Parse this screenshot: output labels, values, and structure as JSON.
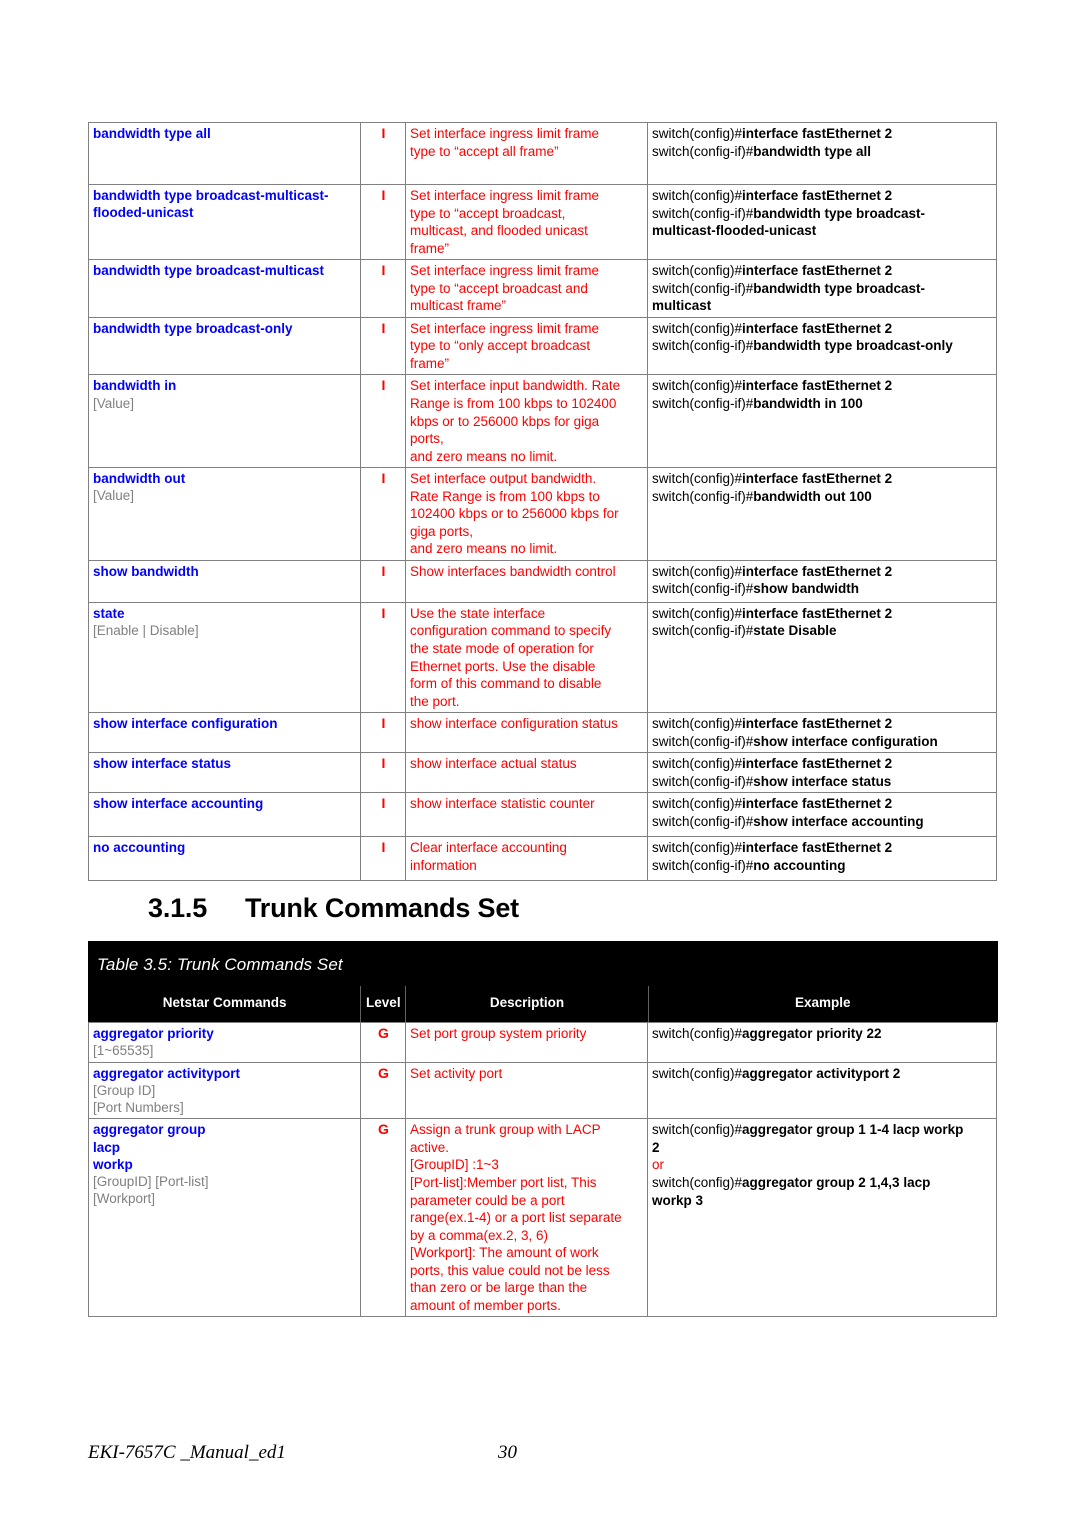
{
  "document": {
    "footer_doc_name": "EKI-7657C _Manual_ed1",
    "footer_page_number": "30"
  },
  "section": {
    "number": "3.1.5",
    "title": "Trunk Commands Set"
  },
  "colors": {
    "command_blue": "#0000FF",
    "description_red": "#FF0000",
    "param_gray": "#808080",
    "header_black": "#000000",
    "example_black": "#000000"
  },
  "table_interface": {
    "columns": [
      "Netstar Commands",
      "Level",
      "Description",
      "Example"
    ],
    "rows": [
      {
        "command": "bandwidth type all",
        "params": "",
        "level": "I",
        "description": "Set interface ingress limit frame\ntype to “accept all frame”",
        "example": [
          {
            "prefix": "switch(config)#",
            "cmd": "interface fastEthernet 2"
          },
          {
            "prefix": "switch(config-if)#",
            "cmd": "bandwidth type all"
          }
        ]
      },
      {
        "command": "bandwidth type broadcast-multicast-\nflooded-unicast",
        "params": "",
        "level": "I",
        "description": "Set interface ingress limit frame\ntype to “accept broadcast,\nmulticast, and flooded unicast\nframe”",
        "example": [
          {
            "prefix": "switch(config)#",
            "cmd": "interface fastEthernet 2"
          },
          {
            "prefix": "switch(config-if)#",
            "cmd": "bandwidth type broadcast-"
          },
          {
            "prefix": "",
            "cmd": "multicast-flooded-unicast"
          }
        ]
      },
      {
        "command": "bandwidth type broadcast-multicast",
        "params": "",
        "level": "I",
        "description": "Set interface ingress limit frame\ntype to “accept broadcast and\nmulticast frame”",
        "example": [
          {
            "prefix": "switch(config)#",
            "cmd": "interface fastEthernet 2"
          },
          {
            "prefix": "switch(config-if)#",
            "cmd": "bandwidth type broadcast-"
          },
          {
            "prefix": "",
            "cmd": "multicast"
          }
        ]
      },
      {
        "command": "bandwidth type broadcast-only",
        "params": "",
        "level": "I",
        "description": "Set interface ingress limit frame\ntype to “only accept broadcast\nframe”",
        "example": [
          {
            "prefix": "switch(config)#",
            "cmd": "interface fastEthernet 2"
          },
          {
            "prefix": "switch(config-if)#",
            "cmd": "bandwidth type broadcast-only"
          }
        ]
      },
      {
        "command": "bandwidth in",
        "params": "[Value]",
        "level": "I",
        "description": "Set interface input bandwidth. Rate\nRange is from 100 kbps to 102400\nkbps or to 256000 kbps for giga\nports,\nand zero means no limit.",
        "example": [
          {
            "prefix": "switch(config)#",
            "cmd": "interface fastEthernet 2"
          },
          {
            "prefix": "switch(config-if)#",
            "cmd": "bandwidth in 100"
          }
        ]
      },
      {
        "command": "bandwidth out",
        "params": "[Value]",
        "level": "I",
        "description": "Set interface output bandwidth.\nRate Range is from 100 kbps to\n102400 kbps or to 256000 kbps for\ngiga ports,\nand zero means no limit.",
        "example": [
          {
            "prefix": "switch(config)#",
            "cmd": "interface fastEthernet 2"
          },
          {
            "prefix": "switch(config-if)#",
            "cmd": "bandwidth out 100"
          }
        ]
      },
      {
        "command": "show bandwidth",
        "params": "",
        "level": "I",
        "description": "Show interfaces bandwidth control",
        "example": [
          {
            "prefix": "switch(config)#",
            "cmd": "interface fastEthernet 2"
          },
          {
            "prefix": "switch(config-if)#",
            "cmd": "show bandwidth"
          }
        ]
      },
      {
        "command": "state",
        "params": "[Enable | Disable]",
        "level": "I",
        "description": "Use the state interface\nconfiguration command to specify\nthe state mode of operation for\nEthernet ports. Use the disable\nform of this command to disable\nthe port.",
        "example": [
          {
            "prefix": "switch(config)#",
            "cmd": "interface fastEthernet 2"
          },
          {
            "prefix": "switch(config-if)#",
            "cmd": "state Disable"
          }
        ]
      },
      {
        "command": "show interface configuration",
        "params": "",
        "level": "I",
        "description": "show interface configuration status",
        "example": [
          {
            "prefix": "switch(config)#",
            "cmd": "interface fastEthernet 2"
          },
          {
            "prefix": "switch(config-if)#",
            "cmd": "show interface configuration"
          }
        ]
      },
      {
        "command": "show interface status",
        "params": "",
        "level": "I",
        "description": "show interface actual status",
        "example": [
          {
            "prefix": "switch(config)#",
            "cmd": "interface fastEthernet 2"
          },
          {
            "prefix": "switch(config-if)#",
            "cmd": "show interface status"
          }
        ]
      },
      {
        "command": "show interface accounting",
        "params": "",
        "level": "I",
        "description": "show interface statistic counter",
        "example": [
          {
            "prefix": "switch(config)#",
            "cmd": "interface fastEthernet 2"
          },
          {
            "prefix": "switch(config-if)#",
            "cmd": "show interface accounting"
          }
        ]
      },
      {
        "command": "no accounting",
        "params": "",
        "level": "I",
        "description": "Clear interface accounting\ninformation",
        "example": [
          {
            "prefix": "switch(config)#",
            "cmd": "interface fastEthernet 2"
          },
          {
            "prefix": "switch(config-if)#",
            "cmd": "no accounting"
          }
        ]
      }
    ]
  },
  "table_trunk": {
    "caption": "Table 3.5: Trunk  Commands Set",
    "columns": [
      "Netstar Commands",
      "Level",
      "Description",
      "Example"
    ],
    "rows": [
      {
        "command": "aggregator priority",
        "params": "[1~65535]",
        "level": "G",
        "description": "Set port group system priority",
        "example": [
          {
            "prefix": "switch(config)#",
            "cmd": "aggregator priority 22"
          }
        ]
      },
      {
        "command": "aggregator activityport",
        "params": "[Group ID]\n[Port Numbers]",
        "level": "G",
        "description": "Set activity port",
        "example": [
          {
            "prefix": "switch(config)#",
            "cmd": "aggregator activityport 2"
          }
        ]
      },
      {
        "command": "aggregator group\nlacp\nworkp",
        "params": "[GroupID] [Port-list]\n[Workport]",
        "level": "G",
        "description": "Assign a trunk group with LACP\nactive.\n[GroupID] :1~3\n[Port-list]:Member port list, This\nparameter could be a port\nrange(ex.1-4) or a port list separate\nby a comma(ex.2, 3, 6)\n[Workport]: The amount of work\nports, this value could not be less\nthan zero or be large than the\namount of member ports.",
        "example": [
          {
            "prefix": "switch(config)#",
            "cmd": "aggregator group 1 1-4 lacp workp"
          },
          {
            "prefix": "",
            "cmd": "2"
          },
          {
            "prefix": "",
            "cmd": "",
            "or": "or"
          },
          {
            "prefix": "switch(config)#",
            "cmd": "aggregator group 2 1,4,3 lacp"
          },
          {
            "prefix": "",
            "cmd": "workp 3"
          }
        ]
      }
    ]
  }
}
